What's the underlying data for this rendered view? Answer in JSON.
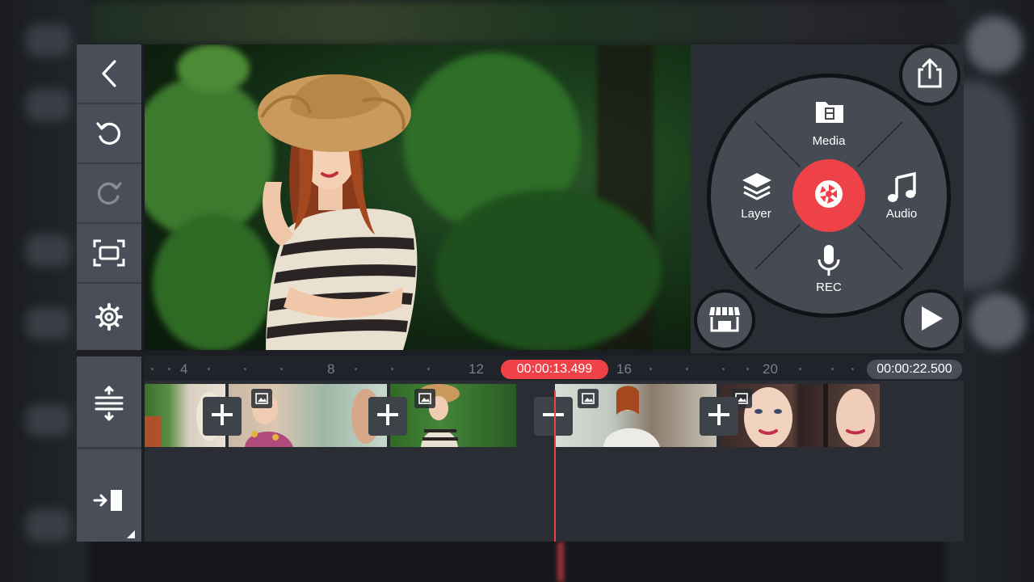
{
  "toolbar": {
    "items": [
      {
        "name": "back",
        "icon": "chevron-left-icon"
      },
      {
        "name": "undo",
        "icon": "undo-icon"
      },
      {
        "name": "redo",
        "icon": "redo-icon",
        "disabled": true
      },
      {
        "name": "capture",
        "icon": "capture-frame-icon"
      },
      {
        "name": "settings",
        "icon": "gear-icon"
      }
    ]
  },
  "media_wheel": {
    "media_label": "Media",
    "audio_label": "Audio",
    "layer_label": "Layer",
    "rec_label": "REC",
    "center_icon": "camera-shutter-icon",
    "accent_color": "#ee4148"
  },
  "round_buttons": {
    "share_icon": "share-icon",
    "store_icon": "store-icon",
    "play_icon": "play-icon"
  },
  "timeline": {
    "ticks": [
      "4",
      "8",
      "12",
      "16",
      "20"
    ],
    "current_time": "00:00:13.499",
    "total_time": "00:00:22.500",
    "side_tools": [
      "timeline-expand-icon",
      "jump-to-end-icon"
    ],
    "clips": [
      {
        "kind": "plant-woman",
        "has_image_badge": false
      },
      {
        "kind": "floral-woman",
        "has_image_badge": true
      },
      {
        "kind": "hat-woman-green",
        "has_image_badge": true
      },
      {
        "kind": "sitting-woman",
        "has_image_badge": true
      },
      {
        "kind": "portrait-woman",
        "has_image_badge": true
      }
    ],
    "transitions": [
      "add",
      "add",
      "remove",
      "add"
    ]
  },
  "colors": {
    "accent": "#ee4148",
    "panel": "#4a4e58",
    "timeline_bg": "#2a2d34"
  }
}
